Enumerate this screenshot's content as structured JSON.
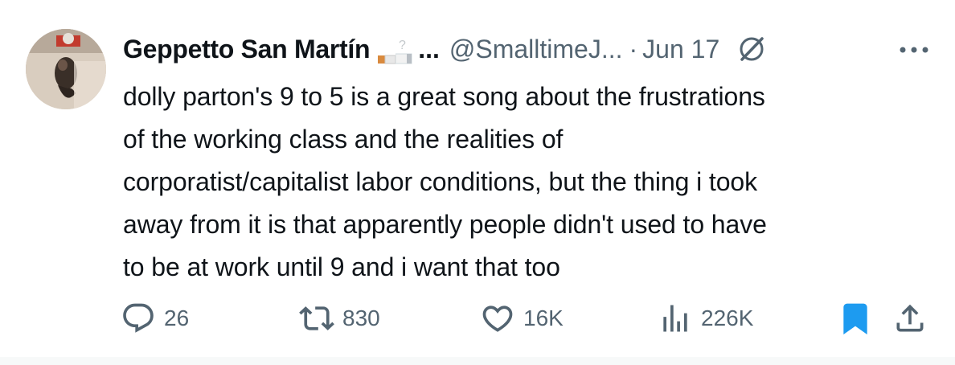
{
  "tweet": {
    "author": {
      "display_name": "Geppetto San Martín",
      "name_ellipsis": "...",
      "handle": "@SmalltimeJ...",
      "separator": "·",
      "date": "Jun 17"
    },
    "text_lines": [
      "dolly parton's 9 to 5 is a great song about the frustrations",
      "of the working class and the realities of",
      "corporatist/capitalist labor conditions, but the thing i took",
      "away from it is that apparently people didn't used to have",
      "to be at work until 9 and i want that too"
    ],
    "actions": {
      "replies": "26",
      "reposts": "830",
      "likes": "16K",
      "views": "226K"
    }
  },
  "colors": {
    "text_primary": "#0f1419",
    "text_secondary": "#536471",
    "bookmark_active": "#1d9bf0"
  },
  "icons": {
    "reply": "reply-bubble-icon",
    "repost": "repost-arrows-icon",
    "like": "heart-icon",
    "views": "views-bars-icon",
    "bookmark": "bookmark-filled-icon",
    "share": "share-upload-icon",
    "grok": "grok-icon",
    "more": "more-dots-icon"
  }
}
